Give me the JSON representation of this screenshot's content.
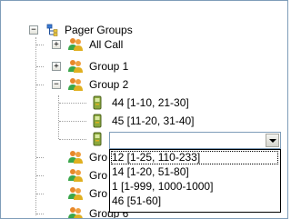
{
  "tree": {
    "root": {
      "label": "Pager Groups",
      "icon": "tree-structure-icon",
      "expander": "−"
    },
    "groups": [
      {
        "label": "All Call",
        "expander": "+",
        "icon": "user-group-icon"
      },
      {
        "label": "Group 1",
        "expander": "+",
        "icon": "user-group-icon"
      },
      {
        "label": "Group 2",
        "expander": "−",
        "icon": "user-group-icon",
        "children": [
          {
            "label": "44 [1-10, 21-30]",
            "icon": "pager-icon"
          },
          {
            "label": "45 [11-20, 31-40]",
            "icon": "pager-icon"
          },
          {
            "label": "",
            "icon": "pager-icon",
            "editing": true
          }
        ]
      },
      {
        "label": "Gro",
        "icon": "user-group-icon"
      },
      {
        "label": "Gro",
        "icon": "user-group-icon"
      },
      {
        "label": "Gro",
        "icon": "user-group-icon"
      },
      {
        "label": "Group 6",
        "icon": "user-group-icon"
      }
    ]
  },
  "combo": {
    "value": "",
    "options": [
      "12 [1-25, 110-233]",
      "14 [1-20, 51-80]",
      "1 [1-999, 1000-1000]",
      "46 [51-60]"
    ]
  },
  "colors": {
    "border": "#7f9db9",
    "tree_lines": "#a0a0a0",
    "group_icon_orange": "#e8882a",
    "group_icon_green": "#3aa64a",
    "pager_icon": "#8aa83c"
  }
}
